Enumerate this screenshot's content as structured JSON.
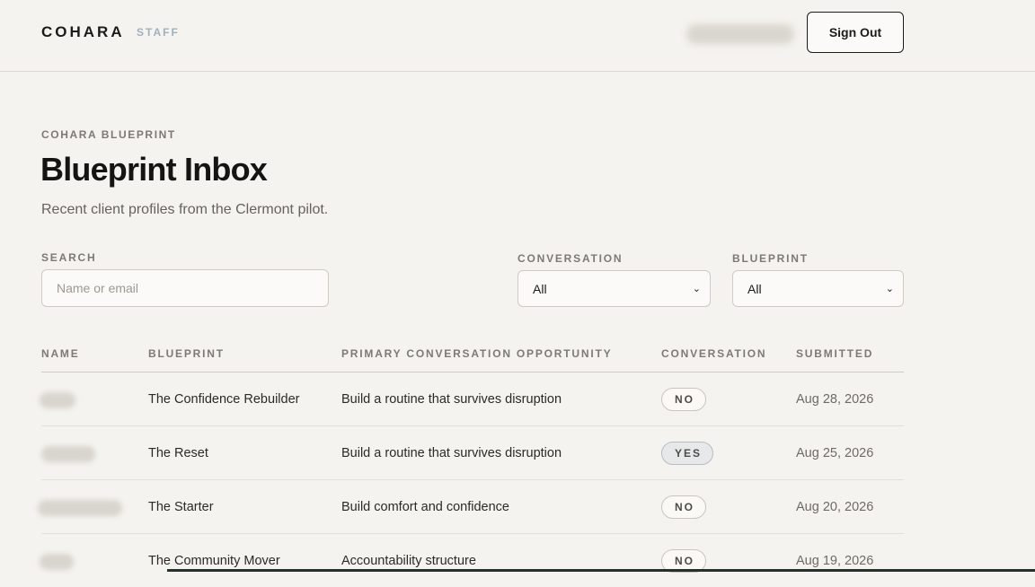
{
  "header": {
    "brand": "COHARA",
    "brand_sub": "STAFF",
    "sign_out_label": "Sign Out"
  },
  "page": {
    "eyebrow": "COHARA BLUEPRINT",
    "title": "Blueprint Inbox",
    "subtitle": "Recent client profiles from the Clermont pilot."
  },
  "filters": {
    "search_label": "SEARCH",
    "search_placeholder": "Name or email",
    "conversation_label": "CONVERSATION",
    "conversation_value": "All",
    "blueprint_label": "BLUEPRINT",
    "blueprint_value": "All"
  },
  "table": {
    "headers": [
      "NAME",
      "BLUEPRINT",
      "PRIMARY CONVERSATION OPPORTUNITY",
      "CONVERSATION",
      "SUBMITTED"
    ],
    "rows": [
      {
        "blueprint": "The Confidence Rebuilder",
        "opportunity": "Build a routine that survives disruption",
        "conversation": "NO",
        "submitted": "Aug 28, 2026"
      },
      {
        "blueprint": "The Reset",
        "opportunity": "Build a routine that survives disruption",
        "conversation": "YES",
        "submitted": "Aug 25, 2026"
      },
      {
        "blueprint": "The Starter",
        "opportunity": "Build comfort and confidence",
        "conversation": "NO",
        "submitted": "Aug 20, 2026"
      },
      {
        "blueprint": "The Community Mover",
        "opportunity": "Accountability structure",
        "conversation": "NO",
        "submitted": "Aug 19, 2026"
      }
    ]
  },
  "icons": {
    "select_chevron": "chevron-down-icon"
  }
}
